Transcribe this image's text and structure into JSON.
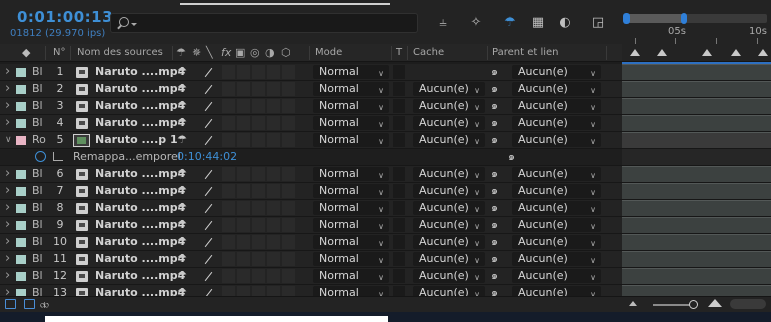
{
  "timecode": "0:01:00:13",
  "frame_info": "01812 (29.970 ips)",
  "search": {
    "placeholder": ""
  },
  "ruler": {
    "labels": [
      "05s",
      "10s"
    ]
  },
  "columns": {
    "num": "N°",
    "source": "Nom des sources",
    "mode": "Mode",
    "t": "T",
    "cache": "Cache",
    "parent": "Parent et lien",
    "fx": "fx"
  },
  "colors": {
    "accent": "#3e8fd6",
    "label_aqua": "#a8cfc8",
    "label_pink": "#e8b4c4"
  },
  "icons": {
    "shy": "shy-icon",
    "pickwhip": "parent-pickwhip-icon",
    "stopwatch": "stopwatch-icon",
    "graph": "graph-editor-icon"
  },
  "layers": [
    {
      "label": "Bl",
      "num": "1",
      "name": "Naruto ....mp4",
      "mode": "Normal",
      "cache": "",
      "parent": "Aucun(e)",
      "expanded": false
    },
    {
      "label": "Bl",
      "num": "2",
      "name": "Naruto ....mp4",
      "mode": "Normal",
      "cache": "Aucun(e)",
      "parent": "Aucun(e)",
      "expanded": false
    },
    {
      "label": "Bl",
      "num": "3",
      "name": "Naruto ....mp4",
      "mode": "Normal",
      "cache": "Aucun(e)",
      "parent": "Aucun(e)",
      "expanded": false
    },
    {
      "label": "Bl",
      "num": "4",
      "name": "Naruto ....mp4",
      "mode": "Normal",
      "cache": "Aucun(e)",
      "parent": "Aucun(e)",
      "expanded": false
    },
    {
      "label": "Ro",
      "num": "5",
      "name": "Naruto ....p 1",
      "mode": "Normal",
      "cache": "Aucun(e)",
      "parent": "Aucun(e)",
      "expanded": true
    },
    {
      "label": "Bl",
      "num": "6",
      "name": "Naruto ....mp4",
      "mode": "Normal",
      "cache": "Aucun(e)",
      "parent": "Aucun(e)",
      "expanded": false
    },
    {
      "label": "Bl",
      "num": "7",
      "name": "Naruto ....mp4",
      "mode": "Normal",
      "cache": "Aucun(e)",
      "parent": "Aucun(e)",
      "expanded": false
    },
    {
      "label": "Bl",
      "num": "8",
      "name": "Naruto ....mp4",
      "mode": "Normal",
      "cache": "Aucun(e)",
      "parent": "Aucun(e)",
      "expanded": false
    },
    {
      "label": "Bl",
      "num": "9",
      "name": "Naruto ....mp4",
      "mode": "Normal",
      "cache": "Aucun(e)",
      "parent": "Aucun(e)",
      "expanded": false
    },
    {
      "label": "Bl",
      "num": "10",
      "name": "Naruto ....mp4",
      "mode": "Normal",
      "cache": "Aucun(e)",
      "parent": "Aucun(e)",
      "expanded": false
    },
    {
      "label": "Bl",
      "num": "11",
      "name": "Naruto ....mp4",
      "mode": "Normal",
      "cache": "Aucun(e)",
      "parent": "Aucun(e)",
      "expanded": false
    },
    {
      "label": "Bl",
      "num": "12",
      "name": "Naruto ....mp4",
      "mode": "Normal",
      "cache": "Aucun(e)",
      "parent": "Aucun(e)",
      "expanded": false
    },
    {
      "label": "Bl",
      "num": "13",
      "name": "Naruto ....mp4",
      "mode": "Normal",
      "cache": "Aucun(e)",
      "parent": "Aucun(e)",
      "expanded": false
    }
  ],
  "remap": {
    "name": "Remappa...emporel",
    "value": "0:10:44:02"
  }
}
